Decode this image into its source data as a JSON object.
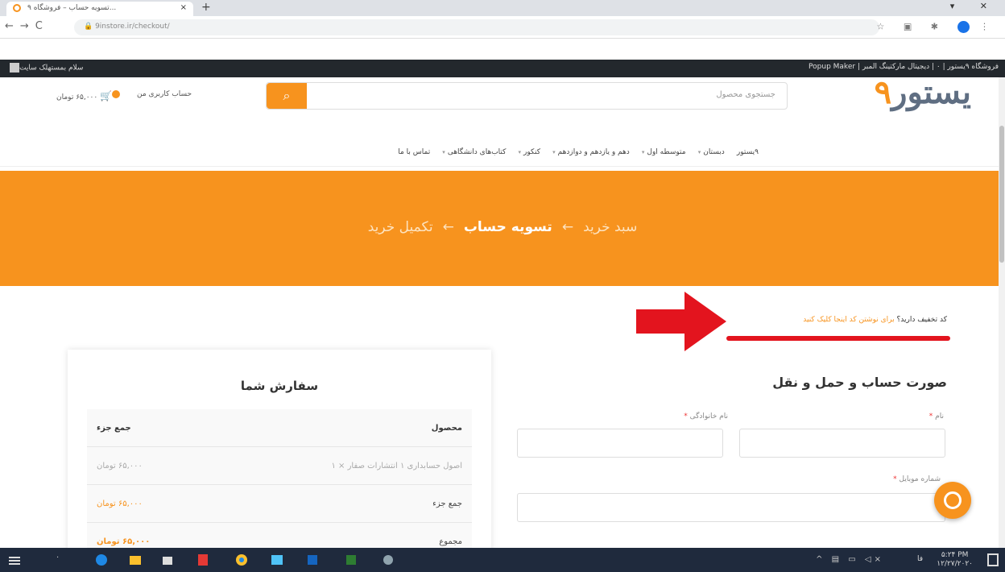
{
  "browser": {
    "tab_title": "تسویه حساب – فروشگاه ۹...",
    "url": "9instore.ir/checkout/",
    "new_tab": "+",
    "close_tab": "×",
    "window_controls": "▾ ✕"
  },
  "adminbar": {
    "right_items": "فروشگاه ۹یستور  |  ۰  |  دیجیتال مارکتینگ المبر  |  Popup Maker",
    "left_greeting": "سلام بمستهلک سایت"
  },
  "header": {
    "logo_nine": "۹",
    "logo_text": "یستور",
    "search_placeholder": "جستجوی محصول",
    "account_label": "حساب کاربری من",
    "cart_label": "۶۵,۰۰۰ تومان"
  },
  "menu": {
    "items": [
      "۹یستور",
      "دبستان",
      "متوسطه اول",
      "دهم و یازدهم و دوازدهم",
      "کنکور",
      "کتاب‌های دانشگاهی",
      "تماس با ما"
    ]
  },
  "banner": {
    "step1": "سبد خرید",
    "arrow": "←",
    "step2": "تسویه حساب",
    "step3": "تکمیل خرید"
  },
  "coupon": {
    "question": "کد تخفیف دارید؟",
    "link": "برای نوشتن کد اینجا کلیک کنید"
  },
  "billing": {
    "title": "صورت حساب و حمل و نقل",
    "first_name_label": "نام",
    "last_name_label": "نام خانوادگی",
    "mobile_label": "شماره موبایل",
    "required_mark": "*"
  },
  "order": {
    "title": "سفارش شما",
    "col_product": "محصول",
    "col_subtotal": "جمع جزء",
    "rows": [
      {
        "product": "اصول حسابداری ۱ انتشارات صفار  × ۱",
        "amount": "۶۵,۰۰۰ تومان"
      }
    ],
    "subtotal_label": "جمع جزء",
    "subtotal_value": "۶۵,۰۰۰ تومان",
    "total_label": "مجموع",
    "total_value": "۶۵,۰۰۰ تومان"
  },
  "taskbar": {
    "time": "۵:۲۴ PM",
    "date": "۱۲/۲۷/۲۰۲۰",
    "lang": "فا"
  },
  "colors": {
    "brand_orange": "#f7931e",
    "annotation_red": "#e3141e",
    "adminbar": "#23282d",
    "taskbar": "#1f2a3d"
  }
}
